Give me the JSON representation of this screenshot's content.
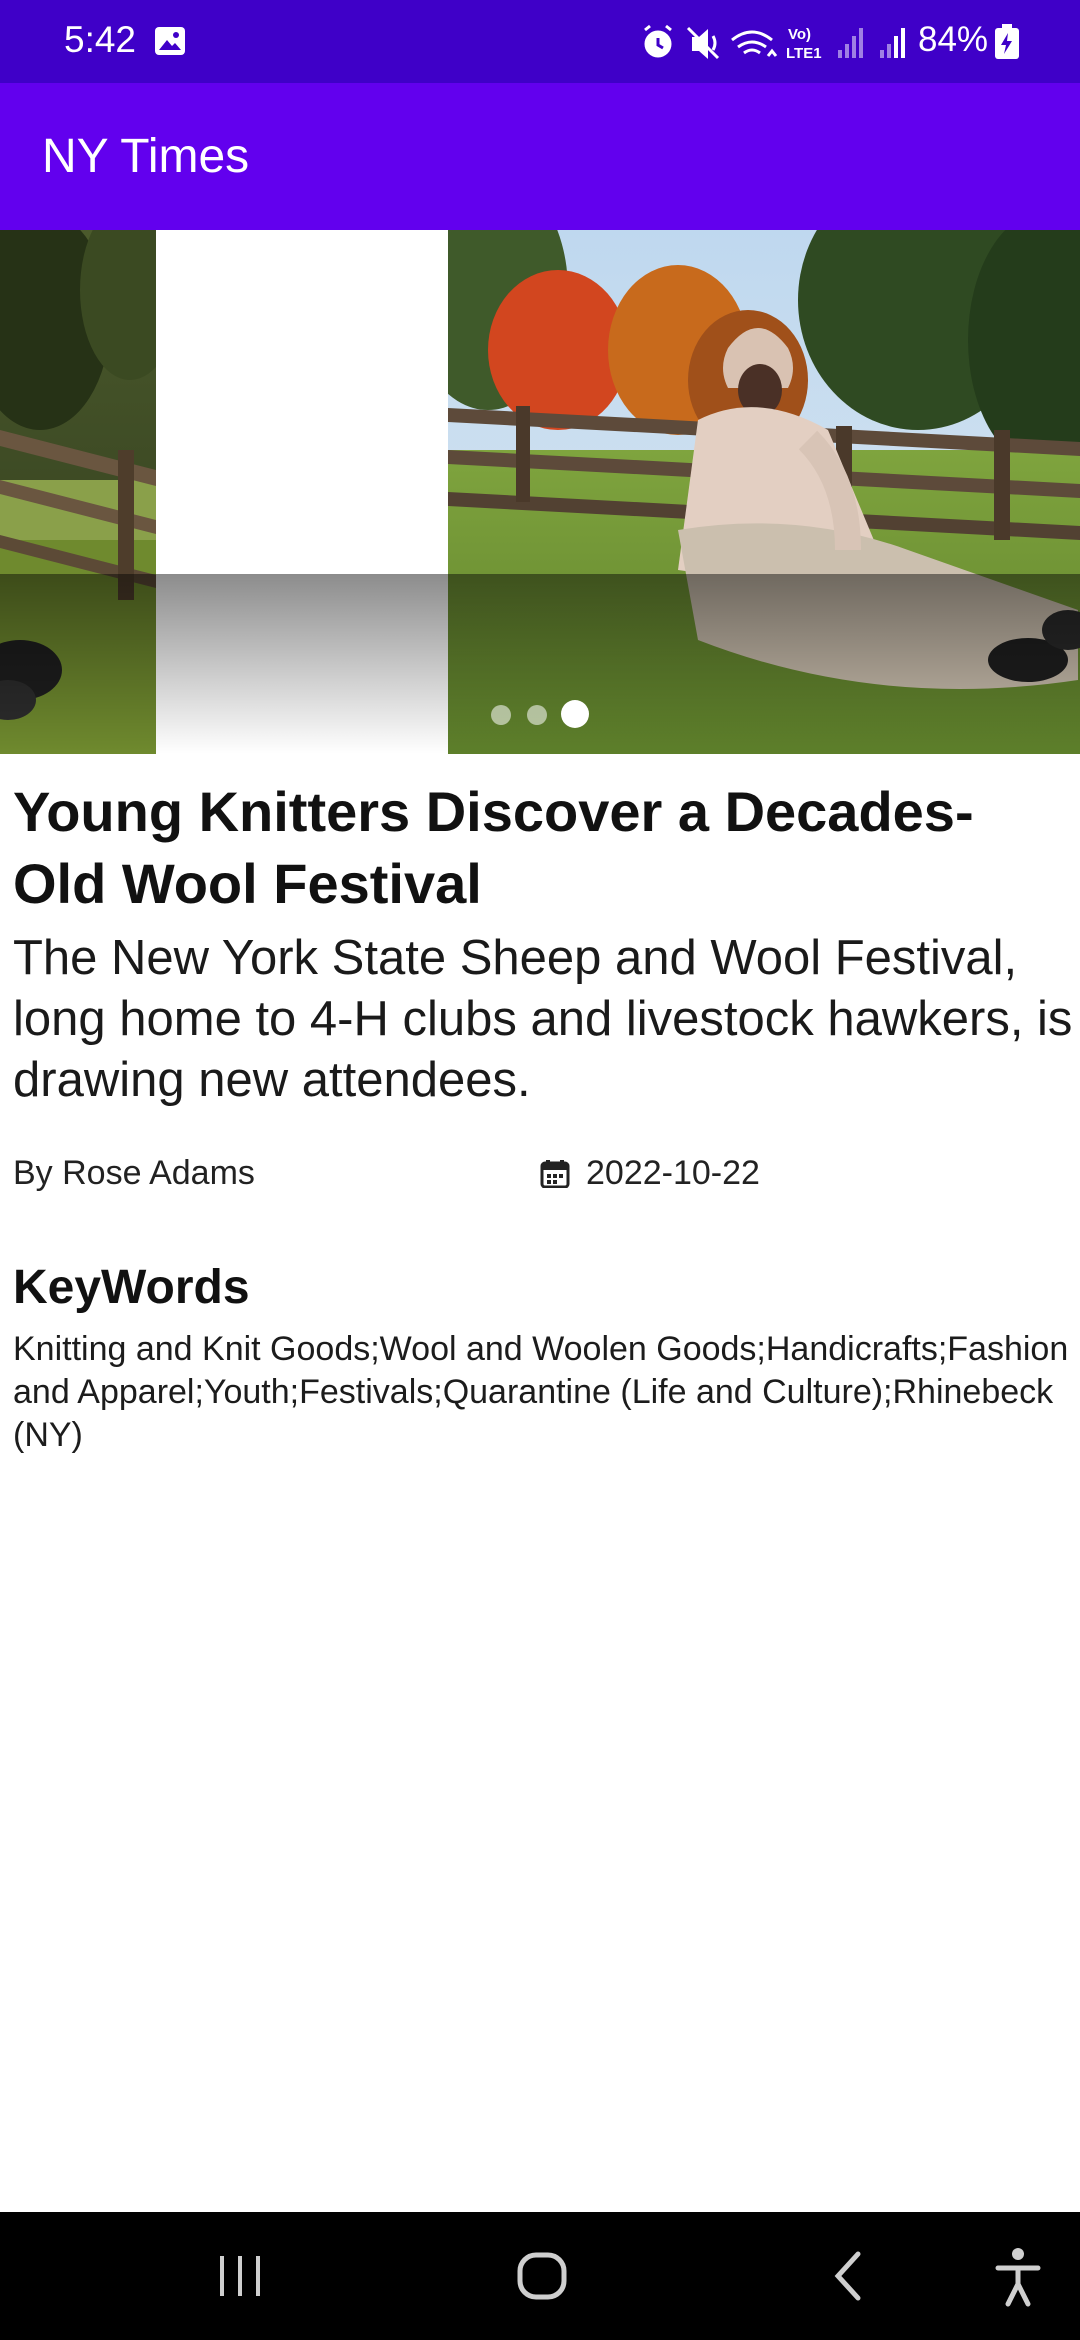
{
  "status_bar": {
    "time": "5:42",
    "battery_percent": "84%",
    "icons": [
      "gallery-icon",
      "alarm-icon",
      "mute-icon",
      "wifi-icon",
      "volte-icon",
      "signal-icon",
      "signal-icon",
      "battery-charging-icon"
    ]
  },
  "app_bar": {
    "title": "NY Times",
    "color": "#6200ee"
  },
  "carousel": {
    "slide_count": 3,
    "active_index": 2
  },
  "article": {
    "headline": "Young Knitters Discover a Decades-Old Wool Festival",
    "abstract": "The New York State Sheep and Wool Festival, long home to 4-H clubs and livestock hawkers, is drawing new attendees.",
    "byline": "By Rose Adams",
    "date": "2022-10-22"
  },
  "keywords": {
    "title": "KeyWords",
    "text": "Knitting and Knit Goods;Wool and Woolen Goods;Handicrafts;Fashion and Apparel;Youth;Festivals;Quarantine (Life and Culture);Rhinebeck (NY)"
  },
  "nav_bar": {
    "buttons": [
      "recents-icon",
      "home-icon",
      "back-icon",
      "accessibility-icon"
    ]
  }
}
